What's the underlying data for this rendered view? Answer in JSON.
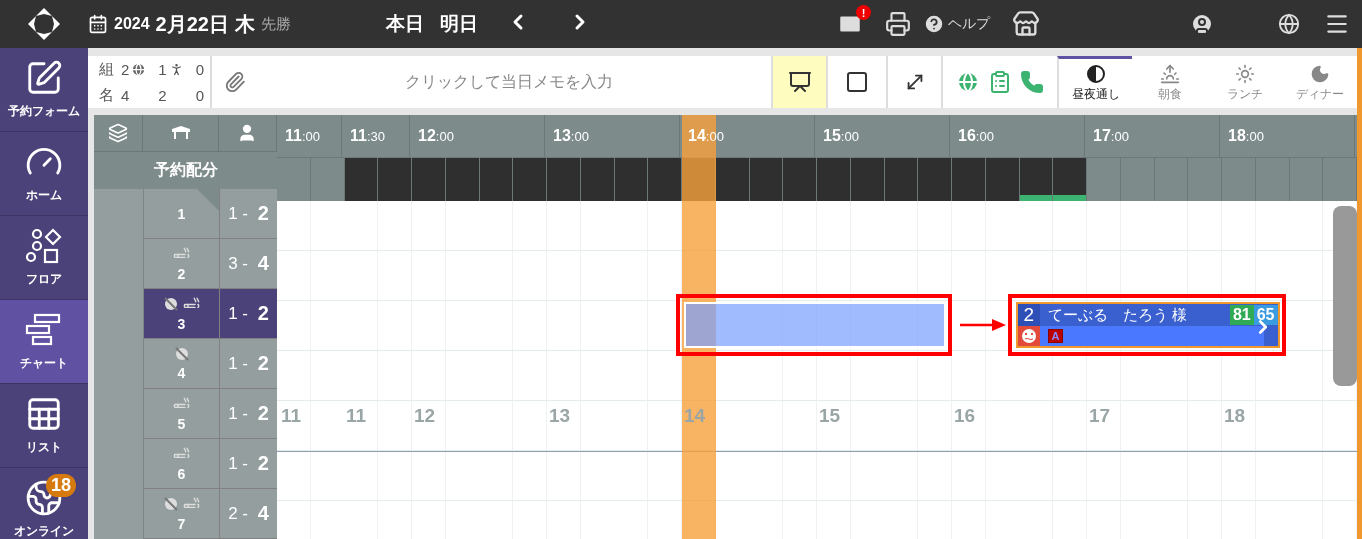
{
  "top_bar": {
    "year": "2024",
    "date": "2月22日",
    "weekday": "木",
    "rokuyo": "先勝",
    "nav": [
      {
        "label": "本日"
      },
      {
        "label": "明日"
      }
    ],
    "mail_badge": "!",
    "help": "ヘルプ"
  },
  "sidebar": {
    "items": [
      {
        "label": "予約フォーム",
        "selected": false
      },
      {
        "label": "ホーム",
        "selected": false
      },
      {
        "label": "フロア",
        "selected": false
      },
      {
        "label": "チャート",
        "selected": true
      },
      {
        "label": "リスト",
        "selected": false
      },
      {
        "label": "オンライン",
        "selected": false,
        "badge": "18"
      }
    ]
  },
  "toolbar": {
    "stats": [
      {
        "label": "組",
        "total": "2",
        "web": "1",
        "walk_in": "0"
      },
      {
        "label": "名",
        "total": "4",
        "web": "2",
        "walk_in": "0"
      }
    ],
    "memo_placeholder": "クリックして当日メモを入力",
    "tools": [
      {
        "kind": "layout",
        "selected": true
      },
      {
        "kind": "square",
        "selected": false
      },
      {
        "kind": "expand",
        "selected": false
      }
    ],
    "meal_tabs": [
      {
        "label": "昼夜通し",
        "selected": true
      },
      {
        "label": "朝食",
        "selected": false
      },
      {
        "label": "ランチ",
        "selected": false
      },
      {
        "label": "ディナー",
        "selected": false
      }
    ]
  },
  "chart": {
    "time_labels": [
      "**11**:00",
      "**11**:30",
      "**12**:00",
      "**13**:00",
      "**14**:00",
      "**15**:00",
      "**16**:00",
      "**17**:00",
      "**18**:00"
    ],
    "allocation_label": "予約配分",
    "slots": [
      {
        "open": false,
        "booked": false
      },
      {
        "open": false,
        "booked": false
      },
      {
        "open": true,
        "booked": false
      },
      {
        "open": true,
        "booked": false
      },
      {
        "open": true,
        "booked": false
      },
      {
        "open": true,
        "booked": false
      },
      {
        "open": true,
        "booked": false
      },
      {
        "open": true,
        "booked": false
      },
      {
        "open": true,
        "booked": false
      },
      {
        "open": true,
        "booked": false
      },
      {
        "open": true,
        "booked": false
      },
      {
        "open": true,
        "booked": false
      },
      {
        "open": true,
        "booked": false
      },
      {
        "open": true,
        "booked": false
      },
      {
        "open": true,
        "booked": false
      },
      {
        "open": true,
        "booked": false
      },
      {
        "open": true,
        "booked": false
      },
      {
        "open": true,
        "booked": false
      },
      {
        "open": true,
        "booked": false
      },
      {
        "open": true,
        "booked": false
      },
      {
        "open": true,
        "booked": false
      },
      {
        "open": true,
        "booked": false
      },
      {
        "open": true,
        "booked": true
      },
      {
        "open": true,
        "booked": true
      },
      {
        "open": false,
        "booked": false
      },
      {
        "open": false,
        "booked": false
      },
      {
        "open": false,
        "booked": false
      },
      {
        "open": false,
        "booked": false
      },
      {
        "open": false,
        "booked": false
      },
      {
        "open": false,
        "booked": false
      },
      {
        "open": false,
        "booked": false
      },
      {
        "open": false,
        "booked": false
      }
    ],
    "rows": [
      {
        "table": "1",
        "capacity": "1 - **2**",
        "web_blocked": false,
        "smoking": false,
        "selected": false
      },
      {
        "table": "2",
        "capacity": "3 - **4**",
        "web_blocked": false,
        "smoking": true,
        "selected": false
      },
      {
        "table": "3",
        "capacity": "1 - **2**",
        "web_blocked": true,
        "smoking": true,
        "selected": true
      },
      {
        "table": "4",
        "capacity": "1 - **2**",
        "web_blocked": true,
        "smoking": false,
        "selected": false
      },
      {
        "table": "5",
        "capacity": "1 - **2**",
        "web_blocked": false,
        "smoking": true,
        "selected": false
      },
      {
        "table": "6",
        "capacity": "1 - **2**",
        "web_blocked": false,
        "smoking": true,
        "selected": false
      },
      {
        "table": "7",
        "capacity": "2 - **4**",
        "web_blocked": true,
        "smoking": true,
        "selected": false
      }
    ],
    "grid_hour_labels": [
      "11",
      "11",
      "12",
      "13",
      "14",
      "15",
      "16",
      "17",
      "18"
    ],
    "ghost_block": {
      "highlighted": true
    },
    "reservation": {
      "party": "2",
      "name": "てーぶる　たろう 様",
      "score_1": "81",
      "score_2": "65",
      "badge": "A",
      "highlighted": true
    },
    "annotation_arrow": true
  }
}
